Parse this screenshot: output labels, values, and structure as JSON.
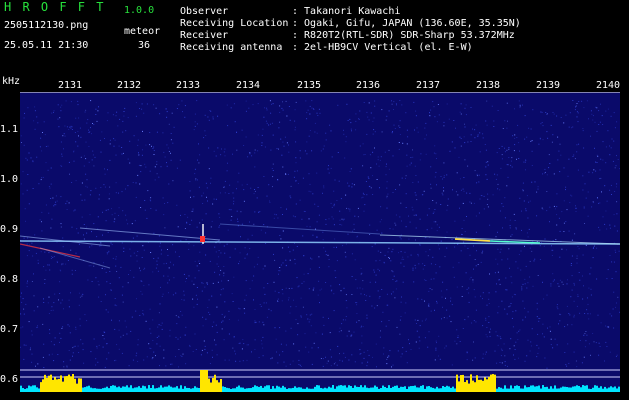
{
  "app": {
    "name": "H R O F F T",
    "version": "1.0.0",
    "filename": "2505112130.png",
    "type_label": "meteor",
    "datetime": "25.05.11 21:30",
    "count": "36"
  },
  "info": {
    "labels": [
      "Observer",
      "Receiving Location",
      "Receiver",
      "Receiving antenna"
    ],
    "values": [
      ": Takanori Kawachi",
      ": Ogaki, Gifu, JAPAN (136.60E, 35.35N)",
      ": R820T2(RTL-SDR) SDR-Sharp 53.372MHz",
      ": 2el-HB9CV Vertical (el. E-W)"
    ]
  },
  "axes": {
    "y_unit": "kHz",
    "y_ticks": [
      "1.1",
      "1.0",
      "0.9",
      "0.8",
      "0.7",
      "0.6"
    ],
    "x_ticks": [
      "2131",
      "2132",
      "2133",
      "2134",
      "2135",
      "2136",
      "2137",
      "2138",
      "2139",
      "2140"
    ]
  },
  "colors": {
    "background": "#000000",
    "waterfall": "#0a0a6a",
    "noise": "#2f3fd0",
    "header_green": "#27e03c",
    "spectrum": "#00e5ff",
    "peak": "#ffe600"
  }
}
